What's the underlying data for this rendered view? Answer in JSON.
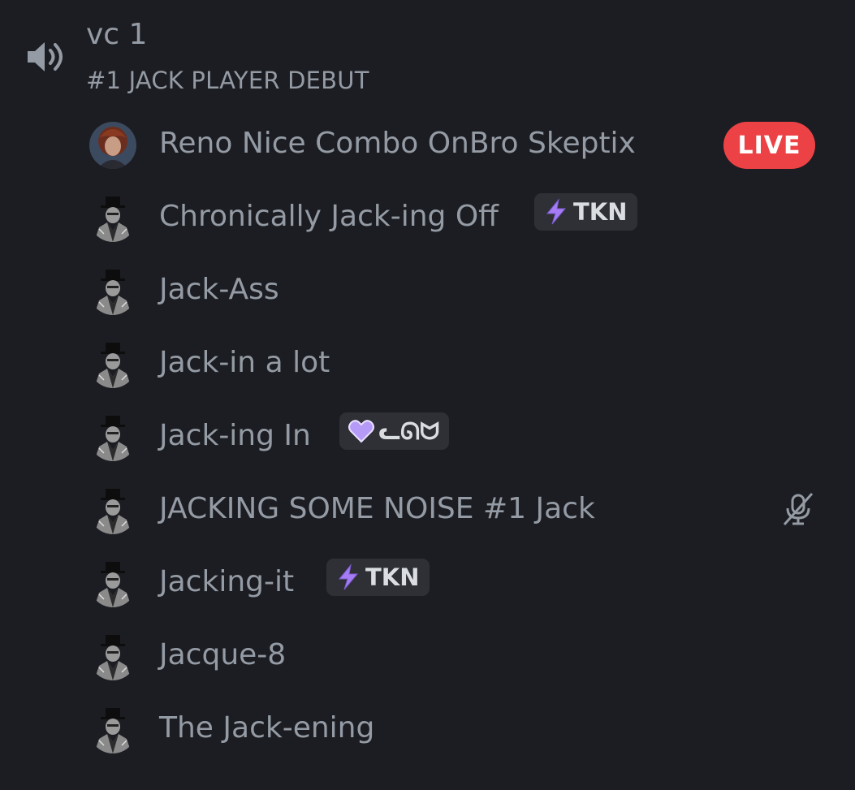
{
  "channel": {
    "name": "vc 1",
    "status": "#1 JACK PLAYER DEBUT",
    "icon": "speaker-icon"
  },
  "users": [
    {
      "name": "Reno Nice Combo OnBro Skeptix",
      "avatar": "photo-avatar",
      "live_label": "LIVE"
    },
    {
      "name": "Chronically Jack-ing Off",
      "avatar": "top-hat-man-avatar",
      "tag": {
        "icon": "lightning-bolt-icon",
        "text": "TKN"
      }
    },
    {
      "name": "Jack-Ass",
      "avatar": "top-hat-man-avatar"
    },
    {
      "name": "Jack-in a lot",
      "avatar": "top-hat-man-avatar"
    },
    {
      "name": "Jack-ing In",
      "avatar": "top-hat-man-avatar",
      "tag": {
        "icon": "purple-heart-icon",
        "text": "ᓚᘏᗢ"
      }
    },
    {
      "name": "JACKING SOME NOISE #1 Jack",
      "avatar": "top-hat-man-avatar",
      "status_icon": "microphone-muted-icon"
    },
    {
      "name": "Jacking-it",
      "avatar": "top-hat-man-avatar",
      "tag": {
        "icon": "lightning-bolt-icon",
        "text": "TKN"
      }
    },
    {
      "name": "Jacque-8",
      "avatar": "top-hat-man-avatar"
    },
    {
      "name": "The Jack-ening",
      "avatar": "top-hat-man-avatar"
    }
  ],
  "colors": {
    "background": "#1c1d22",
    "text_muted": "#949ba4",
    "live_red": "#ed4245",
    "tag_bg": "#2e3036",
    "bolt_purple": "#a57cf5",
    "heart_purple": "#b59bf7"
  }
}
